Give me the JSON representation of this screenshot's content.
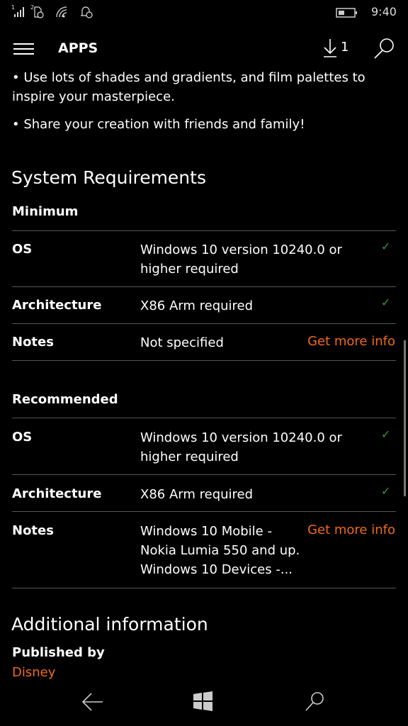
{
  "status_bar": {
    "time": "9:40",
    "signal_sim": "1",
    "sim2": "2",
    "icons": [
      "signal-icon",
      "sim-icon",
      "wifi-icon",
      "notification-icon",
      "battery-icon"
    ]
  },
  "header": {
    "title": "APPS",
    "download_count": "1",
    "icons": [
      "hamburger-icon",
      "download-icon",
      "search-icon"
    ]
  },
  "description": {
    "bullets": [
      "• Use lots of shades and gradients, and film palettes to inspire your masterpiece.",
      "• Share your creation with friends and family!"
    ]
  },
  "requirements": {
    "title": "System Requirements",
    "minimum": {
      "heading": "Minimum",
      "rows": [
        {
          "label": "OS",
          "value": "Windows 10 version 10240.0 or higher required",
          "status": "check"
        },
        {
          "label": "Architecture",
          "value": "X86 Arm required",
          "status": "check"
        },
        {
          "label": "Notes",
          "value": "Not specified",
          "link": "Get more info"
        }
      ]
    },
    "recommended": {
      "heading": "Recommended",
      "rows": [
        {
          "label": "OS",
          "value": "Windows 10 version 10240.0 or higher required",
          "status": "check"
        },
        {
          "label": "Architecture",
          "value": "X86 Arm required",
          "status": "check"
        },
        {
          "label": "Notes",
          "value": "Windows 10 Mobile - Nokia Lumia 550 and up. Windows 10 Devices -...",
          "link": "Get more info"
        }
      ]
    }
  },
  "additional": {
    "title": "Additional information",
    "published_label": "Published by",
    "publisher": "Disney"
  },
  "colors": {
    "accent": "#f06a1a",
    "check": "#2f9a2f",
    "divider": "#555555"
  },
  "nav_bar": {
    "icons": [
      "back-icon",
      "windows-icon",
      "search-icon"
    ]
  }
}
